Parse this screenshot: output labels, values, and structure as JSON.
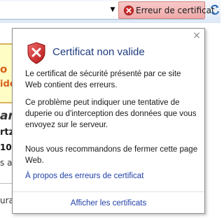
{
  "toolbar": {
    "dropdown_glyph": "▼",
    "cert_error_label": "Erreur de certificat",
    "cert_error_icon": "x-circle-icon",
    "refresh_icon": "refresh-icon"
  },
  "background_page": {
    "line1": "o",
    "line2": "ide",
    "line3": "an",
    "line4": "rtz",
    "line5": "10(",
    "line6": "s a",
    "line7": "ura"
  },
  "popup": {
    "icon": "shield-error-icon",
    "title": "Certificat non valide",
    "paragraph1": "Le certificat de sécurité présenté par ce site Web contient des erreurs.",
    "paragraph2": "Ce problème peut indiquer une tentative de duperie ou d'interception des données que vous envoyez sur le serveur.",
    "paragraph3": "Nous vous recommandons de fermer cette page Web.",
    "link_about": "À propos des erreurs de certificat",
    "link_view": "Afficher les certificats",
    "close_glyph": "×"
  },
  "colors": {
    "title": "#1e3b80",
    "link": "#1f3fa8",
    "error_red": "#d12b2b",
    "error_button_bg": "#f0a9a9"
  }
}
